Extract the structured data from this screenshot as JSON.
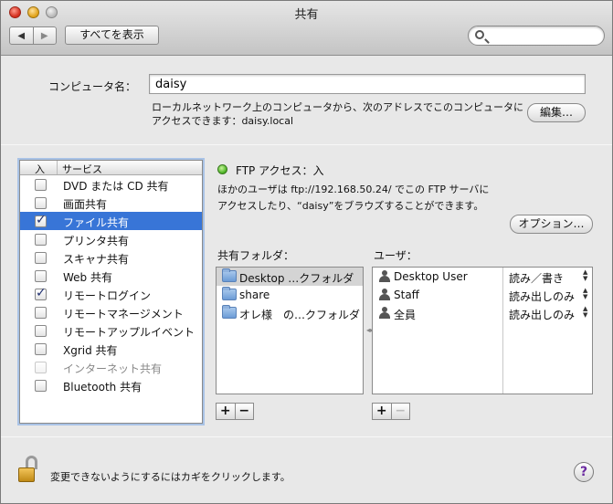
{
  "window": {
    "title": "共有"
  },
  "toolbar": {
    "back": "◀",
    "forward": "▶",
    "show_all": "すべてを表示",
    "search_value": ""
  },
  "computer": {
    "label": "コンピュータ名：",
    "name": "daisy",
    "description_line1": "ローカルネットワーク上のコンピュータから、次のアドレスでこのコンピュータに",
    "description_line2": "アクセスできます：daisy.local",
    "edit_button": "編集…"
  },
  "services": {
    "header_on": "入",
    "header_service": "サービス",
    "items": [
      {
        "name": "DVD または CD 共有",
        "checked": false,
        "selected": false
      },
      {
        "name": "画面共有",
        "checked": false,
        "selected": false
      },
      {
        "name": "ファイル共有",
        "checked": true,
        "selected": true
      },
      {
        "name": "プリンタ共有",
        "checked": false,
        "selected": false
      },
      {
        "name": "スキャナ共有",
        "checked": false,
        "selected": false
      },
      {
        "name": "Web 共有",
        "checked": false,
        "selected": false
      },
      {
        "name": "リモートログイン",
        "checked": true,
        "selected": false
      },
      {
        "name": "リモートマネージメント",
        "checked": false,
        "selected": false
      },
      {
        "name": "リモートアップルイベント",
        "checked": false,
        "selected": false
      },
      {
        "name": "Xgrid 共有",
        "checked": false,
        "selected": false
      },
      {
        "name": "インターネット共有",
        "checked": false,
        "selected": false,
        "dimmed": true
      },
      {
        "name": "Bluetooth 共有",
        "checked": false,
        "selected": false
      }
    ]
  },
  "ftp": {
    "status": "FTP アクセス：入",
    "status_color": "#46b020",
    "desc_line1": "ほかのユーザは ftp://192.168.50.24/ でこの FTP サーバに",
    "desc_line2": "アクセスしたり、“daisy”をブラウズすることができます。",
    "options_button": "オプション…"
  },
  "shared_folders": {
    "label": "共有フォルダ：",
    "items": [
      {
        "name": "Desktop …クフォルダ",
        "icon": "folder-icon",
        "selected": true
      },
      {
        "name": "share",
        "icon": "folder-icon",
        "selected": false
      },
      {
        "name": "オレ様　の…クフォルダ",
        "icon": "public-folder-icon",
        "selected": false
      }
    ],
    "add": "+",
    "remove": "−"
  },
  "users": {
    "label": "ユーザ：",
    "items": [
      {
        "name": "Desktop User",
        "icon": "user-icon",
        "permission": "読み／書き"
      },
      {
        "name": "Staff",
        "icon": "group-icon",
        "permission": "読み出しのみ"
      },
      {
        "name": "全員",
        "icon": "everyone-icon",
        "permission": "読み出しのみ"
      }
    ],
    "add": "+",
    "remove": "−"
  },
  "footer": {
    "lock_text": "変更できないようにするにはカギをクリックします。",
    "help": "?"
  }
}
